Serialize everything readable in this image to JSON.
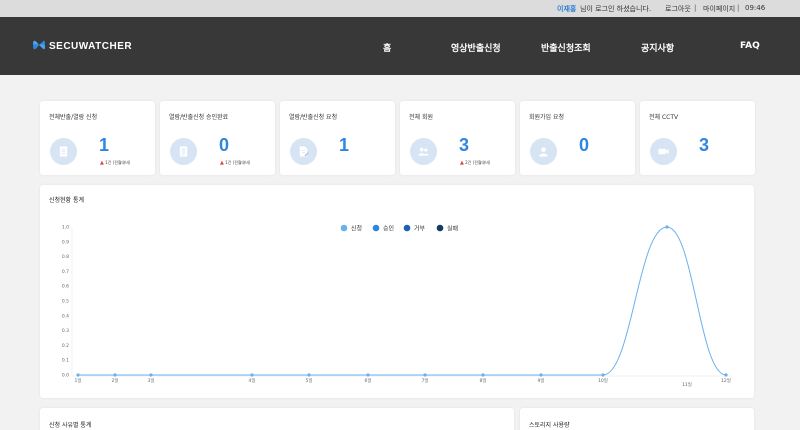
{
  "topbar": {
    "user_name": "이재홍",
    "greeting": " 님이 로그인 하셨습니다.",
    "logout": "로그아웃",
    "separator": "|",
    "mypage": "마이페이지",
    "time": "09:46"
  },
  "nav": {
    "logo_text": "SECUWATCHER",
    "menu": [
      "홈",
      "영상반출신청",
      "반출신청조회",
      "공지사항",
      "FAQ"
    ]
  },
  "cards": [
    {
      "title": "전체반출/열람 신청",
      "value": "1",
      "sub": "1건 (전월대비)",
      "icon": "document-icon"
    },
    {
      "title": "열람/반출신청 승인완료",
      "value": "0",
      "sub": "1건 (전월대비)",
      "icon": "document-list-icon"
    },
    {
      "title": "열람/반출신청 요청",
      "value": "1",
      "sub": "",
      "icon": "document-edit-icon"
    },
    {
      "title": "전체 회원",
      "value": "3",
      "sub": "2건 (전월대비)",
      "icon": "users-icon"
    },
    {
      "title": "회원가입 요청",
      "value": "0",
      "sub": "",
      "icon": "user-icon"
    },
    {
      "title": "전체 CCTV",
      "value": "3",
      "sub": "",
      "icon": "camera-icon"
    }
  ],
  "chart_section_title": "신청현황 통계",
  "bottom_left_title": "신청 사유별 통계",
  "bottom_right_title": "스토리지 사용량",
  "colors": {
    "accent": "#2f86e0",
    "nav_bg": "#383838",
    "trend_up": "#e03a3a"
  },
  "chart_data": {
    "type": "line",
    "x": [
      "1일",
      "2일",
      "3일",
      "4일",
      "5일",
      "6일",
      "7일",
      "8일",
      "9일",
      "10일",
      "11일",
      "12일"
    ],
    "series": [
      {
        "name": "신청",
        "values": [
          0,
          0,
          0,
          0,
          0,
          0,
          0,
          0,
          0,
          0,
          1,
          0
        ],
        "color": "#6ab0ee"
      },
      {
        "name": "승인",
        "values": [],
        "color": "#2f86e0"
      },
      {
        "name": "거부",
        "values": [],
        "color": "#2060b0"
      },
      {
        "name": "실패",
        "values": [],
        "color": "#163a66"
      }
    ],
    "yticks": [
      "0.0",
      "0.1",
      "0.2",
      "0.3",
      "0.4",
      "0.5",
      "0.6",
      "0.7",
      "0.8",
      "0.9",
      "1.0"
    ],
    "ylim": [
      0,
      1
    ],
    "grid": false,
    "legend_position": "top-center"
  }
}
